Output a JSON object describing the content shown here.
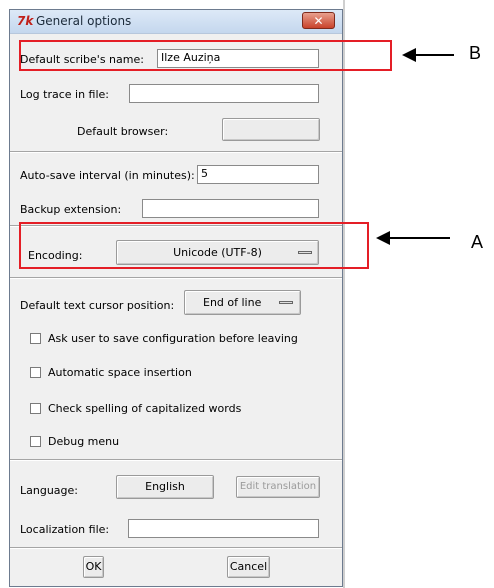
{
  "window": {
    "title": "General options",
    "app_icon": "tk-icon",
    "close_label": "✕"
  },
  "fields": {
    "scribe_name": {
      "label": "Default scribe's name:",
      "value": "Ilze Auziņa"
    },
    "log_trace": {
      "label": "Log trace in file:",
      "value": ""
    },
    "browser": {
      "label": "Default browser:",
      "value": ""
    },
    "autosave": {
      "label": "Auto-save interval (in minutes):",
      "value": "5"
    },
    "backup": {
      "label": "Backup extension:",
      "value": ""
    },
    "encoding": {
      "label": "Encoding:",
      "value": "Unicode (UTF-8)"
    },
    "cursor": {
      "label": "Default text cursor position:",
      "value": "End of line"
    }
  },
  "checkboxes": [
    {
      "label": "Ask user to save configuration before leaving",
      "checked": false
    },
    {
      "label": "Automatic space insertion",
      "checked": false
    },
    {
      "label": "Check spelling of capitalized words",
      "checked": false
    },
    {
      "label": "Debug menu",
      "checked": false
    }
  ],
  "language": {
    "label": "Language:",
    "value": "English",
    "edit_translation": "Edit translation"
  },
  "localization": {
    "label": "Localization file:",
    "value": ""
  },
  "buttons": {
    "ok": "OK",
    "cancel": "Cancel"
  },
  "annotations": {
    "a": "A",
    "b": "B",
    "highlight_color": "#e41e26"
  }
}
